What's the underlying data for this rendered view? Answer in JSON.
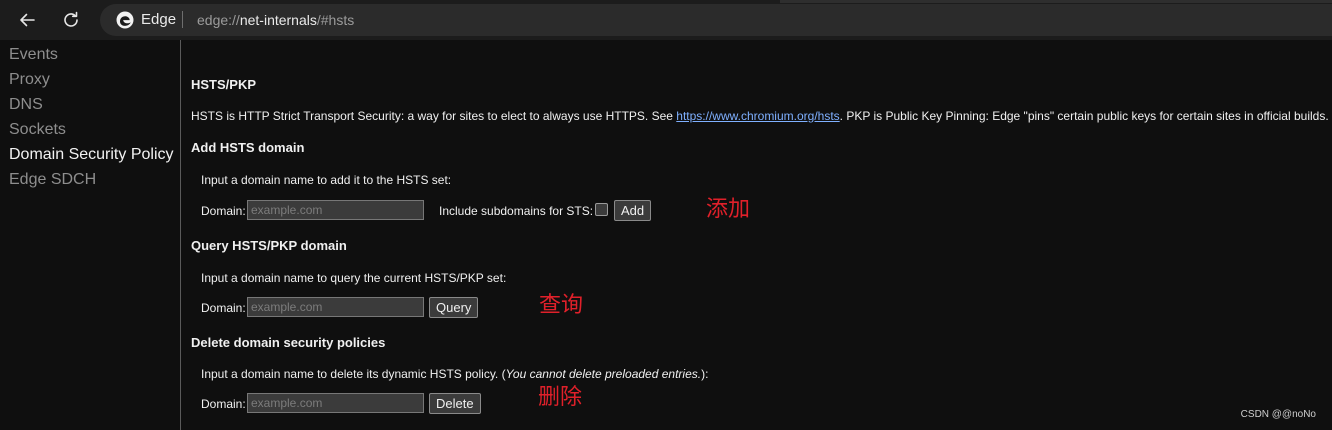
{
  "browser": {
    "site_name": "Edge",
    "url_scheme": "edge://",
    "url_host": "net-internals",
    "url_path": "/#hsts",
    "back_icon": "arrow-left-icon",
    "reload_icon": "reload-icon"
  },
  "sidebar": {
    "items": [
      {
        "label": "Events"
      },
      {
        "label": "Proxy"
      },
      {
        "label": "DNS"
      },
      {
        "label": "Sockets"
      },
      {
        "label": "Domain Security Policy",
        "active": true
      },
      {
        "label": "Edge SDCH"
      }
    ]
  },
  "main": {
    "title": "HSTS/PKP",
    "intro_before_link": "HSTS is HTTP Strict Transport Security: a way for sites to elect to always use HTTPS. See ",
    "intro_link": "https://www.chromium.org/hsts",
    "intro_after_link": ". PKP is Public Key Pinning: Edge \"pins\" certain public keys for certain sites in official builds.",
    "add": {
      "heading": "Add HSTS domain",
      "instruction": "Input a domain name to add it to the HSTS set:",
      "domain_label": "Domain:",
      "domain_placeholder": "example.com",
      "domain_value": "",
      "subdomains_label": "Include subdomains for STS:",
      "button": "Add",
      "annotation": "添加"
    },
    "query": {
      "heading": "Query HSTS/PKP domain",
      "instruction": "Input a domain name to query the current HSTS/PKP set:",
      "domain_label": "Domain:",
      "domain_placeholder": "example.com",
      "domain_value": "",
      "button": "Query",
      "annotation": "查询"
    },
    "delete": {
      "heading": "Delete domain security policies",
      "instruction_before": "Input a domain name to delete its dynamic HSTS policy. (",
      "instruction_italic": "You cannot delete preloaded entries.",
      "instruction_after": "):",
      "domain_label": "Domain:",
      "domain_placeholder": "example.com",
      "domain_value": "",
      "button": "Delete",
      "annotation": "删除"
    }
  },
  "watermark": "CSDN @@noNo",
  "colors": {
    "background": "#0f0f0f",
    "annotation": "#e0202a",
    "link": "#7fb0ff"
  }
}
